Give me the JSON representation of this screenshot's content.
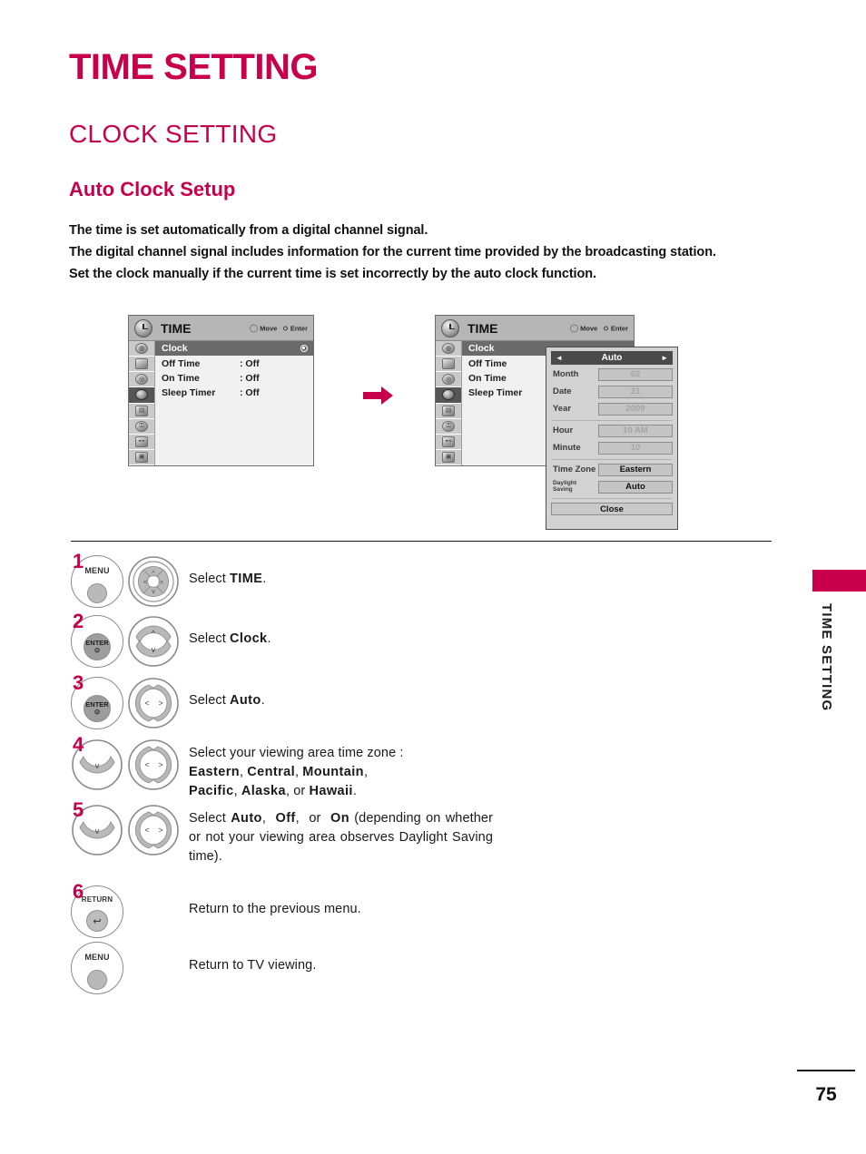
{
  "page": {
    "title": "TIME SETTING",
    "section": "CLOCK SETTING",
    "subsection": "Auto Clock Setup",
    "side_tab": "TIME SETTING",
    "page_number": "75",
    "accent_color": "#C8004B"
  },
  "intro": {
    "line1": "The time is set automatically from a digital channel signal.",
    "line2": "The digital channel signal includes information for the current time provided by the broadcasting station.",
    "line3": "Set the clock manually if the current time is set incorrectly by the auto clock function."
  },
  "osd": {
    "title": "TIME",
    "hint_move": "Move",
    "hint_enter": "Enter",
    "icons": [
      "picture-icon",
      "screen-icon",
      "audio-icon",
      "time-icon",
      "option-icon",
      "lock-icon",
      "input-icon",
      "usb-icon"
    ],
    "rows": [
      {
        "label": "Clock",
        "value": ""
      },
      {
        "label": "Off Time",
        "value": ": Off"
      },
      {
        "label": "On Time",
        "value": ": Off"
      },
      {
        "label": "Sleep Timer",
        "value": ": Off"
      }
    ]
  },
  "dialog": {
    "header": "Auto",
    "arrow_left": "◄",
    "arrow_right": "►",
    "fields": [
      {
        "label": "Month",
        "value": "02",
        "enabled": false
      },
      {
        "label": "Date",
        "value": "21",
        "enabled": false
      },
      {
        "label": "Year",
        "value": "2009",
        "enabled": false
      },
      {
        "label": "Hour",
        "value": "10 AM",
        "enabled": false
      },
      {
        "label": "Minute",
        "value": "10",
        "enabled": false
      },
      {
        "label": "Time Zone",
        "value": "Eastern",
        "enabled": true
      },
      {
        "label": "Daylight Saving",
        "value": "Auto",
        "enabled": true
      }
    ],
    "daylight_label_line1": "Daylight",
    "daylight_label_line2": "Saving",
    "close_label": "Close"
  },
  "steps": [
    {
      "num": "1",
      "button": "MENU",
      "control": "dpad-4way",
      "text_prefix": "Select ",
      "text_bold": "TIME",
      "text_suffix": "."
    },
    {
      "num": "2",
      "button": "ENTER",
      "control": "updown",
      "text_prefix": "Select ",
      "text_bold": "Clock",
      "text_suffix": "."
    },
    {
      "num": "3",
      "button": "ENTER",
      "control": "leftright",
      "text_prefix": "Select ",
      "text_bold": "Auto",
      "text_suffix": "."
    },
    {
      "num": "4",
      "button": "",
      "control": "down-leftright",
      "line1": "Select your viewing area time zone :",
      "zones_line1": [
        "Eastern",
        "Central",
        "Mountain"
      ],
      "zones_line2": [
        "Pacific",
        "Alaska",
        "Hawaii"
      ],
      "zones_line2_conj": "or"
    },
    {
      "num": "5",
      "button": "",
      "control": "down-leftright",
      "lead": "Select ",
      "opt1": "Auto",
      "opt2": "Off",
      "opt3": "On",
      "conj": "or",
      "tail": " (depending on whether or not your viewing area observes Daylight Saving time)."
    },
    {
      "num": "6",
      "button": "RETURN",
      "control": "none",
      "text": "Return to the previous menu."
    },
    {
      "num": "",
      "button": "MENU",
      "control": "none",
      "text": "Return to TV viewing."
    }
  ]
}
